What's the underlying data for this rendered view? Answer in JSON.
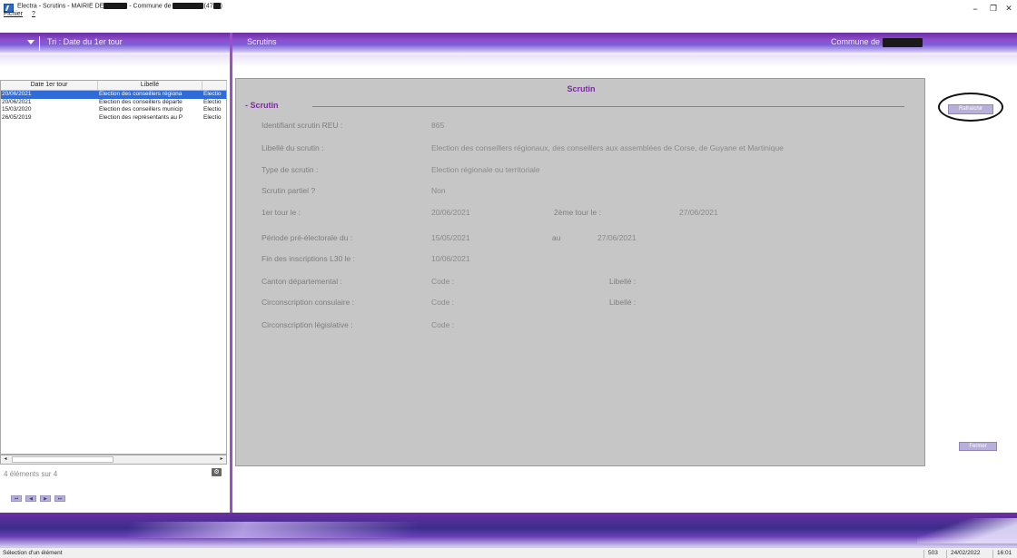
{
  "window": {
    "title_prefix": "Electra - Scrutins - MAIRIE DE",
    "title_mid": " - Commune de ",
    "title_suffix": "(47",
    "title_end": ")",
    "menu": [
      "Fichier",
      "?"
    ],
    "minimize": "–",
    "maximize": "❐",
    "close": "✕"
  },
  "header": {
    "sort_label": "Tri : Date du 1er tour",
    "center_label": "Scrutins",
    "right_label": "Commune de"
  },
  "list": {
    "columns": [
      "Date 1er tour",
      "Libellé",
      ""
    ],
    "rows": [
      {
        "date": "20/06/2021",
        "label": "Election des conseillers régiona",
        "type": "Electio",
        "selected": true
      },
      {
        "date": "20/06/2021",
        "label": "Election des conseillers départe",
        "type": "Electio",
        "selected": false
      },
      {
        "date": "15/03/2020",
        "label": "Élection des conseillers municip",
        "type": "Electio",
        "selected": false
      },
      {
        "date": "26/05/2019",
        "label": "Election des représentants au P",
        "type": "Electio",
        "selected": false
      }
    ],
    "count_text": "4 éléments sur 4",
    "scroll_left": "◂",
    "scroll_right": "▸",
    "gear": "⚙",
    "nav_buttons": [
      "⏮",
      "◀",
      "▶",
      "⏭"
    ]
  },
  "panel": {
    "title": "Scrutin",
    "section": "- Scrutin",
    "fields": {
      "id_label": "Identifiant scrutin REU :",
      "id_value": "865",
      "libelle_label": "Libellé du scrutin :",
      "libelle_value": "Election des conseillers régionaux, des conseillers aux assemblées de Corse, de Guyane et Martinique",
      "type_label": "Type de scrutin :",
      "type_value": "Election régionale ou territoriale",
      "partiel_label": "Scrutin partiel ?",
      "partiel_value": "Non",
      "tour1_label": "1er tour le :",
      "tour1_value": "20/06/2021",
      "tour2_label": "2ème tour le :",
      "tour2_value": "27/06/2021",
      "periode_label": "Période pré-électorale du :",
      "periode_from": "15/05/2021",
      "periode_au": "au",
      "periode_to": "27/06/2021",
      "fin_label": "Fin des inscriptions L30 le :",
      "fin_value": "10/06/2021",
      "canton_label": "Canton départemental :",
      "canton_code": "Code :",
      "canton_libelle": "Libellé :",
      "circ_cons_label": "Circonscription consulaire :",
      "circ_cons_code": "Code :",
      "circ_cons_libelle": "Libellé :",
      "circ_leg_label": "Circonscription législative :",
      "circ_leg_code": "Code :"
    }
  },
  "buttons": {
    "refresh": "Rafraîchir",
    "close": "Fermer"
  },
  "status": {
    "text": "Sélection d'un élément",
    "code": "503",
    "date": "24/02/2022",
    "time": "16:01"
  }
}
